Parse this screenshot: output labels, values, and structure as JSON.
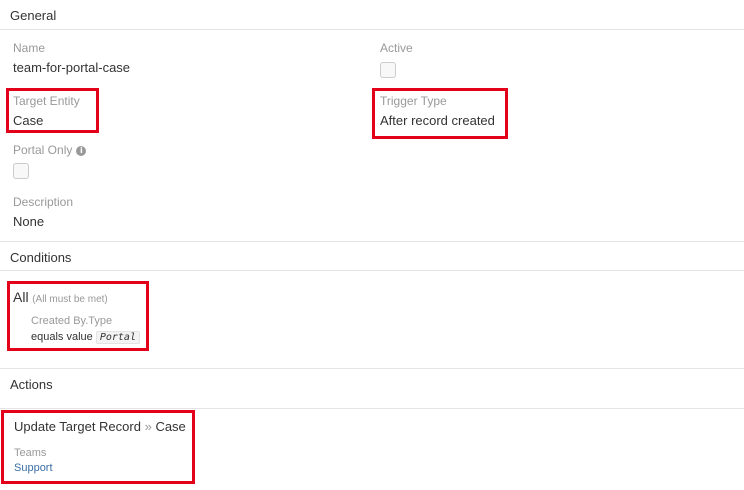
{
  "general": {
    "heading": "General",
    "name_label": "Name",
    "name_value": "team-for-portal-case",
    "active_label": "Active",
    "target_entity_label": "Target Entity",
    "target_entity_value": "Case",
    "trigger_type_label": "Trigger Type",
    "trigger_type_value": "After record created",
    "portal_only_label": "Portal Only",
    "description_label": "Description",
    "description_value": "None"
  },
  "conditions": {
    "heading": "Conditions",
    "group_label": "All",
    "group_note": "(All must be met)",
    "field": "Created By.Type",
    "operator": "equals value",
    "value": "Portal"
  },
  "actions": {
    "heading": "Actions",
    "action_title": "Update Target Record",
    "separator": "»",
    "action_target": "Case",
    "field_label": "Teams",
    "field_value": "Support"
  },
  "colors": {
    "highlight": "#e3001b",
    "link": "#3a6ea5",
    "label": "#999999"
  }
}
